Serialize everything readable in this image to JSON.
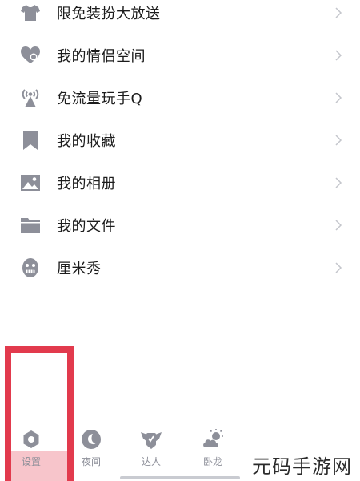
{
  "menu": {
    "items": [
      {
        "label": "限免装扮大放送",
        "icon": "tshirt-icon"
      },
      {
        "label": "我的情侣空间",
        "icon": "heart-icon"
      },
      {
        "label": "免流量玩手Q",
        "icon": "signal-tower-icon"
      },
      {
        "label": "我的收藏",
        "icon": "bookmark-icon"
      },
      {
        "label": "我的相册",
        "icon": "photo-icon"
      },
      {
        "label": "我的文件",
        "icon": "folder-icon"
      },
      {
        "label": "厘米秀",
        "icon": "face-icon"
      }
    ]
  },
  "bottom_nav": {
    "items": [
      {
        "label": "设置",
        "icon": "settings-icon"
      },
      {
        "label": "夜间",
        "icon": "moon-icon"
      },
      {
        "label": "达人",
        "icon": "winged-badge-icon"
      },
      {
        "label": "卧龙",
        "icon": "weather-icon"
      }
    ]
  },
  "watermark": {
    "text": "元码手游网"
  },
  "colors": {
    "icon": "#8d8f99",
    "highlight": "#e23a4d",
    "text": "#1c1c1c"
  }
}
